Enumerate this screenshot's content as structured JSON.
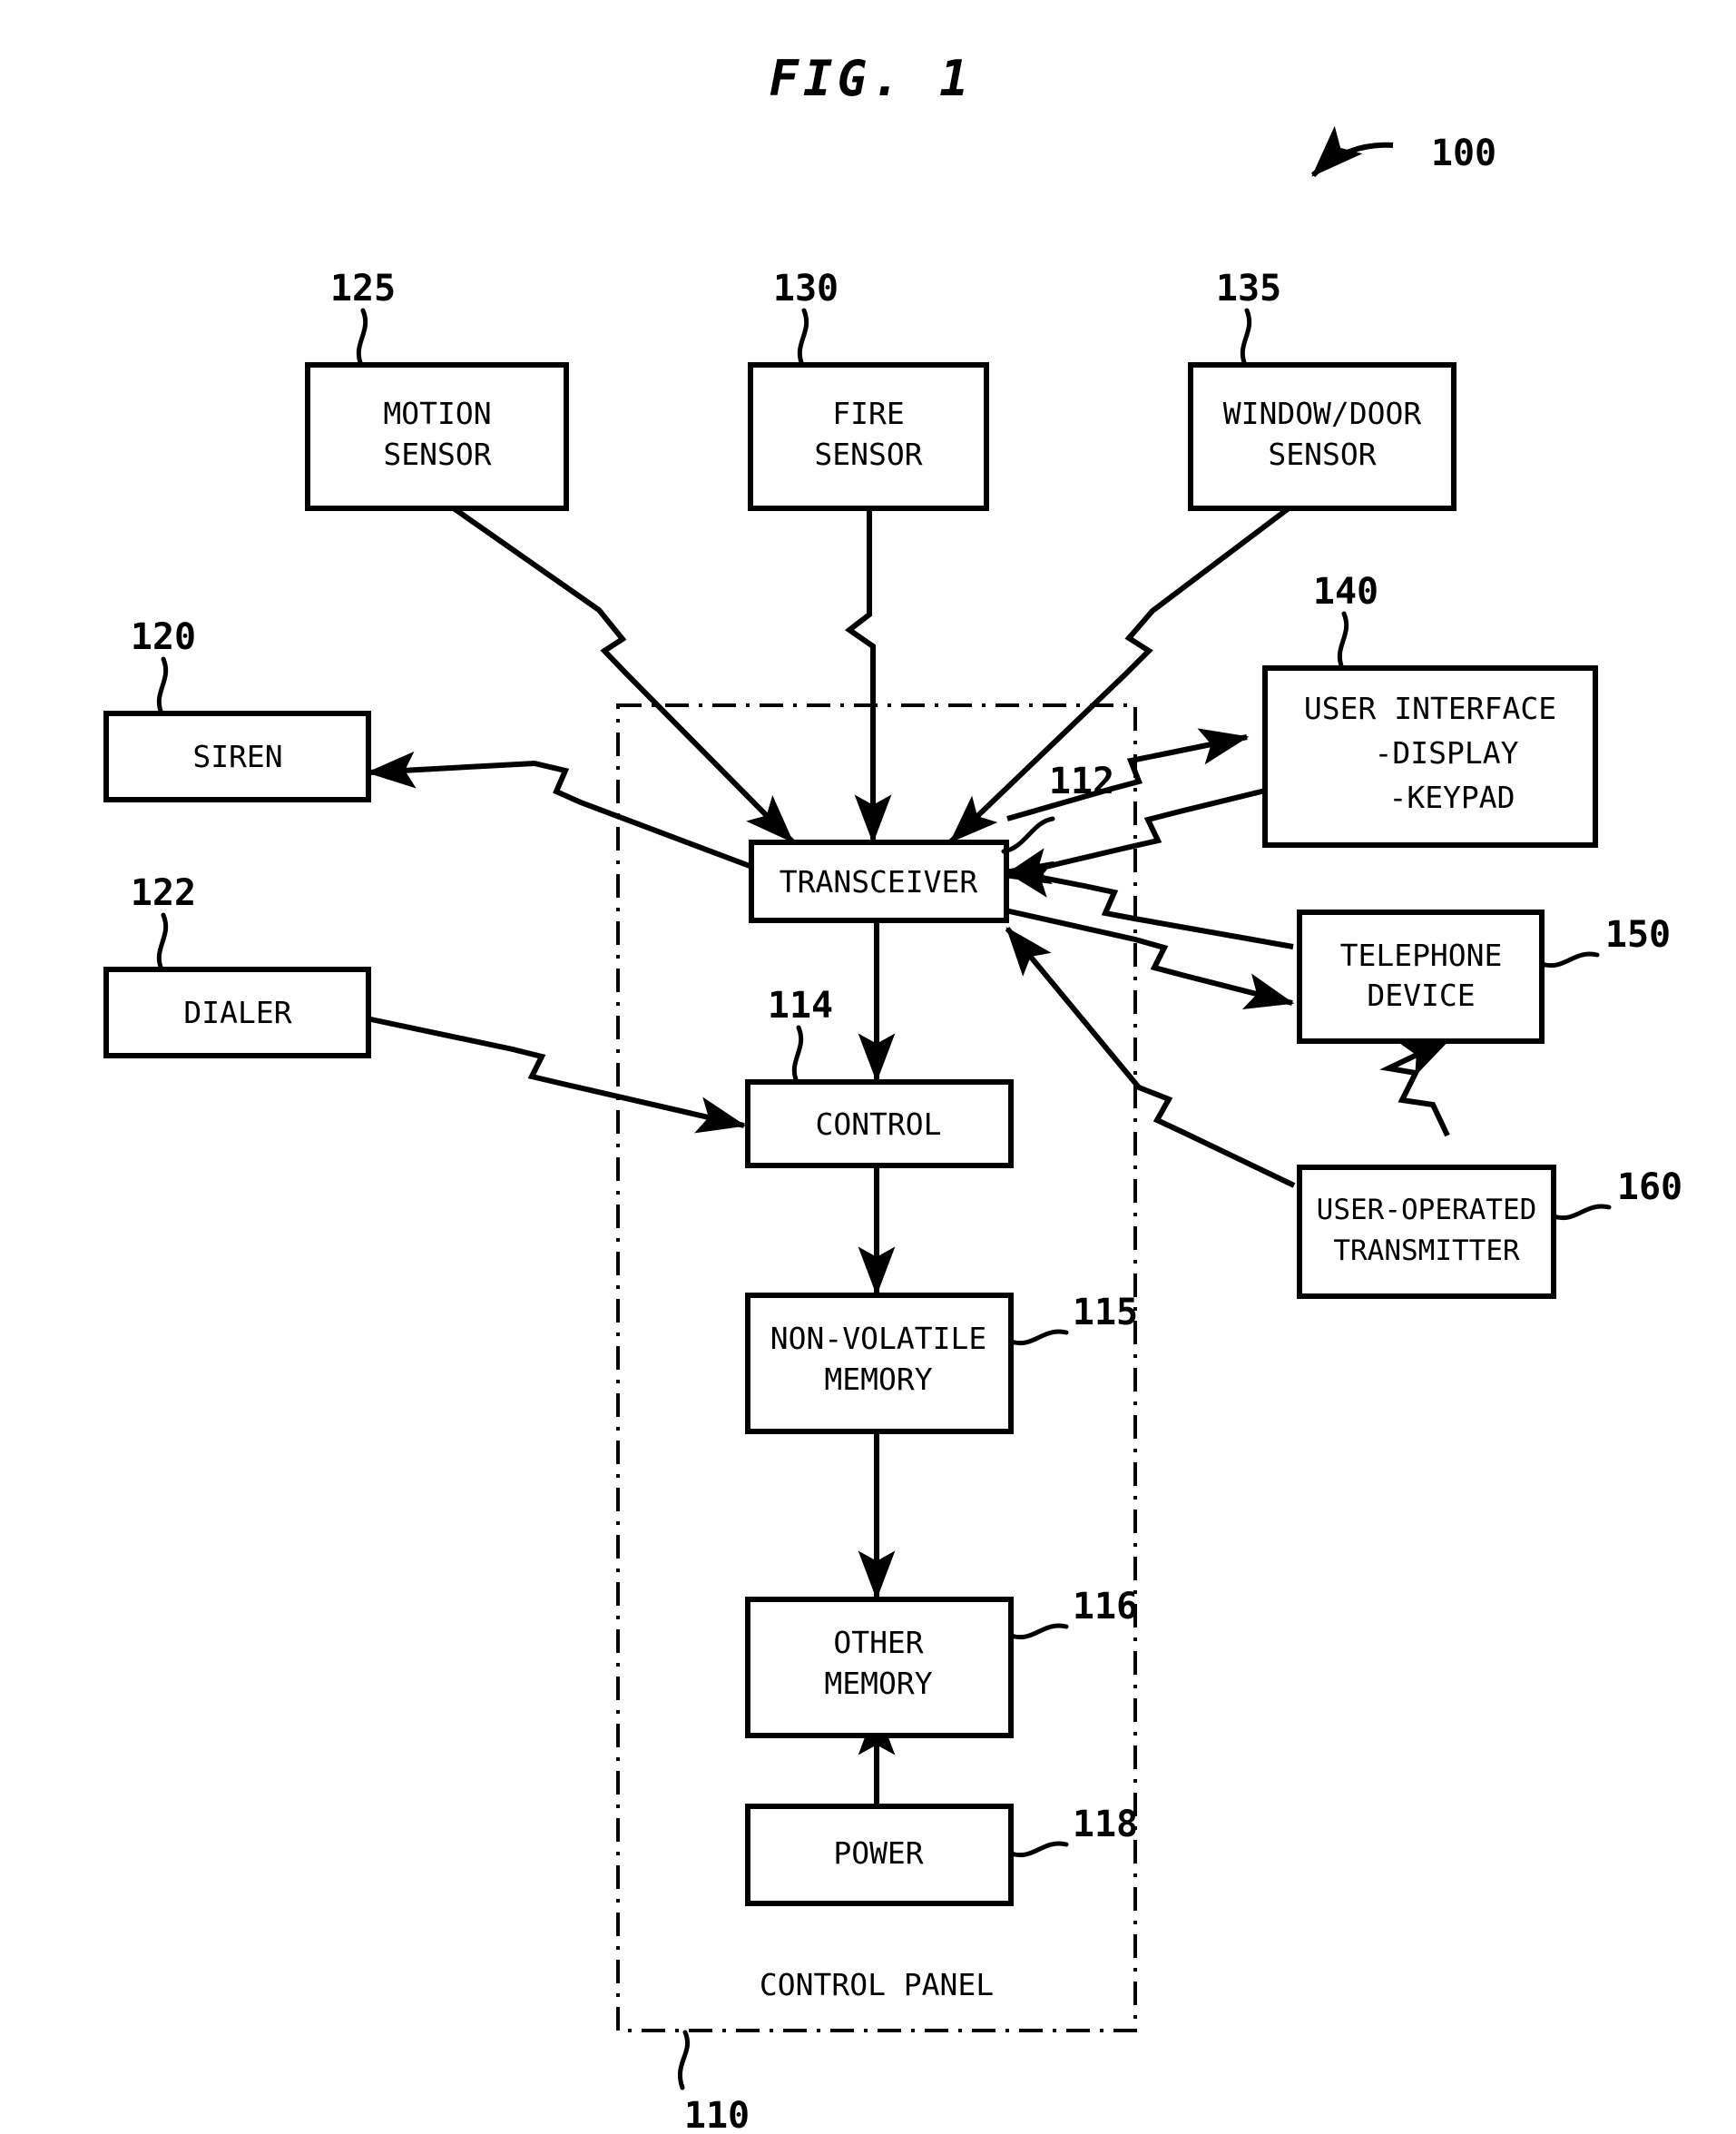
{
  "figure": {
    "title": "FIG. 1",
    "system_ref": "100",
    "panel_label": "CONTROL PANEL",
    "panel_ref": "110"
  },
  "boxes": [
    {
      "id": "motion-sensor",
      "lines": [
        "MOTION",
        "SENSOR"
      ],
      "ref": "125"
    },
    {
      "id": "fire-sensor",
      "lines": [
        "FIRE",
        "SENSOR"
      ],
      "ref": "130"
    },
    {
      "id": "window-door-sensor",
      "lines": [
        "WINDOW/DOOR",
        "SENSOR"
      ],
      "ref": "135"
    },
    {
      "id": "siren",
      "lines": [
        "SIREN"
      ],
      "ref": "120"
    },
    {
      "id": "dialer",
      "lines": [
        "DIALER"
      ],
      "ref": "122"
    },
    {
      "id": "user-interface",
      "lines": [
        "USER INTERFACE",
        "-DISPLAY",
        "-KEYPAD"
      ],
      "ref": "140"
    },
    {
      "id": "telephone-device",
      "lines": [
        "TELEPHONE",
        "DEVICE"
      ],
      "ref": "150"
    },
    {
      "id": "user-operated-transmitter",
      "lines": [
        "USER-OPERATED",
        "TRANSMITTER"
      ],
      "ref": "160"
    },
    {
      "id": "transceiver",
      "lines": [
        "TRANSCEIVER"
      ],
      "ref": "112"
    },
    {
      "id": "control",
      "lines": [
        "CONTROL"
      ],
      "ref": "114"
    },
    {
      "id": "non-volatile-memory",
      "lines": [
        "NON-VOLATILE",
        "MEMORY"
      ],
      "ref": "115"
    },
    {
      "id": "other-memory",
      "lines": [
        "OTHER",
        "MEMORY"
      ],
      "ref": "116"
    },
    {
      "id": "power",
      "lines": [
        "POWER"
      ],
      "ref": "118"
    }
  ],
  "labels": {
    "motion_l1": "MOTION",
    "motion_l2": "SENSOR",
    "fire_l1": "FIRE",
    "fire_l2": "SENSOR",
    "windoor_l1": "WINDOW/DOOR",
    "windoor_l2": "SENSOR",
    "siren": "SIREN",
    "dialer": "DIALER",
    "ui_l1": "USER INTERFACE",
    "ui_l2": "-DISPLAY",
    "ui_l3": "-KEYPAD",
    "tel_l1": "TELEPHONE",
    "tel_l2": "DEVICE",
    "uot_l1": "USER-OPERATED",
    "uot_l2": "TRANSMITTER",
    "transceiver": "TRANSCEIVER",
    "control": "CONTROL",
    "nvm_l1": "NON-VOLATILE",
    "nvm_l2": "MEMORY",
    "om_l1": "OTHER",
    "om_l2": "MEMORY",
    "power": "POWER",
    "control_panel": "CONTROL PANEL"
  },
  "refs": {
    "r100": "100",
    "r110": "110",
    "r112": "112",
    "r114": "114",
    "r115": "115",
    "r116": "116",
    "r118": "118",
    "r120": "120",
    "r122": "122",
    "r125": "125",
    "r130": "130",
    "r135": "135",
    "r140": "140",
    "r150": "150",
    "r160": "160"
  },
  "colors": {
    "ink": "#000000",
    "paper": "#ffffff"
  }
}
